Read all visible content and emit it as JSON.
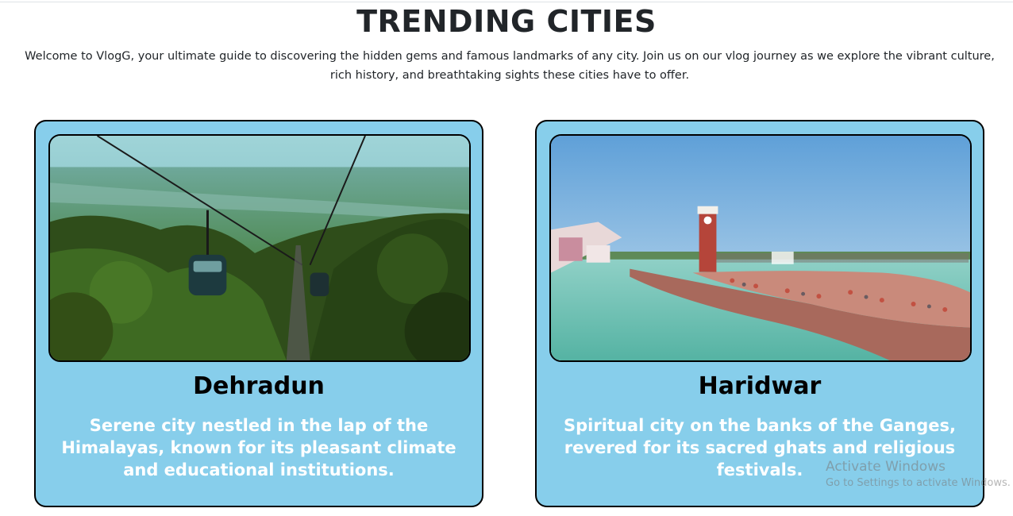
{
  "page": {
    "title": "TRENDING CITIES",
    "intro": "Welcome to VlogG, your ultimate guide to discovering the hidden gems and famous landmarks of any city. Join us on our vlog journey as we explore the vibrant culture, rich history, and breathtaking sights these cities have to offer."
  },
  "cities": [
    {
      "name": "Dehradun",
      "description": "Serene city nestled in the lap of the Himalayas, known for its pleasant climate and educational institutions.",
      "image": "ropeway-cable-cars-over-forest-valley"
    },
    {
      "name": "Haridwar",
      "description": "Spiritual city on the banks of the Ganges, revered for its sacred ghats and religious festivals.",
      "image": "clock-tower-and-ghats-on-the-ganges"
    }
  ],
  "watermark": {
    "line1": "Activate Windows",
    "line2": "Go to Settings to activate Windows."
  },
  "colors": {
    "card_background": "#87ceeb",
    "card_border": "#000000",
    "description_text": "#ffffff",
    "title_text": "#212529"
  }
}
